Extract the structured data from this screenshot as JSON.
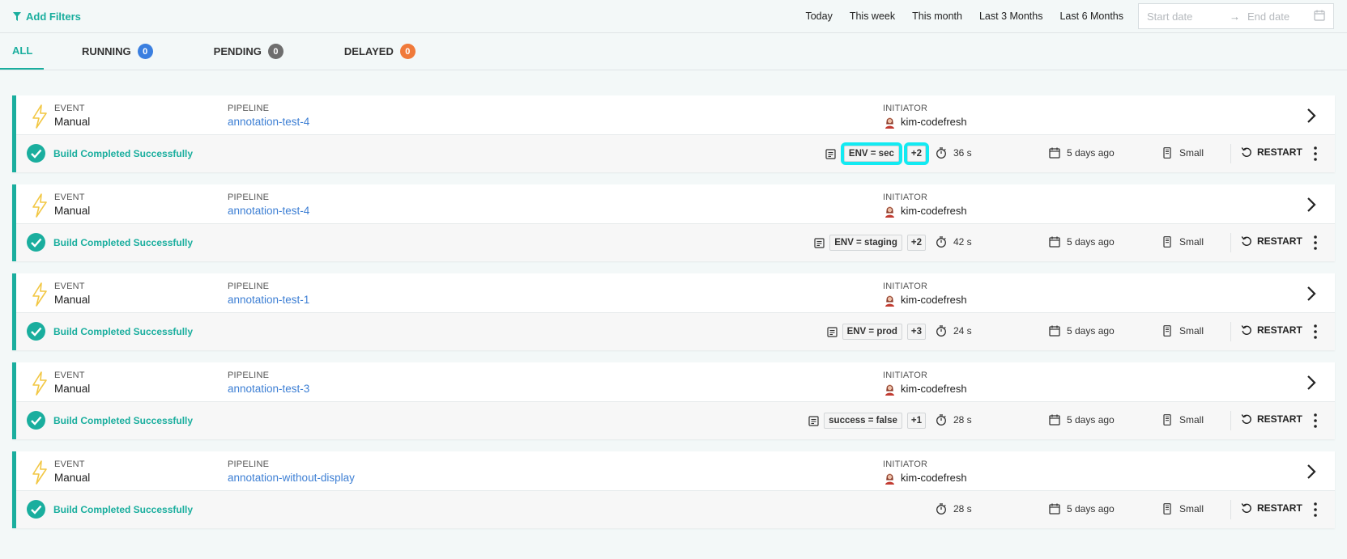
{
  "filters": {
    "add_label": "Add Filters",
    "ranges": [
      "Today",
      "This week",
      "This month",
      "Last 3 Months",
      "Last 6 Months"
    ],
    "start_placeholder": "Start date",
    "end_placeholder": "End date",
    "arrow": "→"
  },
  "tabs": [
    {
      "label": "ALL"
    },
    {
      "label": "RUNNING",
      "count": "0",
      "color": "#3a7fe0"
    },
    {
      "label": "PENDING",
      "count": "0",
      "color": "#6e6e6e"
    },
    {
      "label": "DELAYED",
      "count": "0",
      "color": "#f07a3a"
    }
  ],
  "labels": {
    "event": "EVENT",
    "pipeline": "PIPELINE",
    "initiator": "INITIATOR",
    "restart": "RESTART"
  },
  "builds": [
    {
      "event": "Manual",
      "pipeline": "annotation-test-4",
      "initiator": "kim-codefresh",
      "status": "Build Completed Successfully",
      "annotation": "ENV = sec",
      "more": "+2",
      "duration": "36 s",
      "date": "5 days ago",
      "size": "Small",
      "highlighted": true
    },
    {
      "event": "Manual",
      "pipeline": "annotation-test-4",
      "initiator": "kim-codefresh",
      "status": "Build Completed Successfully",
      "annotation": "ENV = staging",
      "more": "+2",
      "duration": "42 s",
      "date": "5 days ago",
      "size": "Small",
      "highlighted": false
    },
    {
      "event": "Manual",
      "pipeline": "annotation-test-1",
      "initiator": "kim-codefresh",
      "status": "Build Completed Successfully",
      "annotation": "ENV = prod",
      "more": "+3",
      "duration": "24 s",
      "date": "5 days ago",
      "size": "Small",
      "highlighted": false
    },
    {
      "event": "Manual",
      "pipeline": "annotation-test-3",
      "initiator": "kim-codefresh",
      "status": "Build Completed Successfully",
      "annotation": "success = false",
      "more": "+1",
      "duration": "28 s",
      "date": "5 days ago",
      "size": "Small",
      "highlighted": false
    },
    {
      "event": "Manual",
      "pipeline": "annotation-without-display",
      "initiator": "kim-codefresh",
      "status": "Build Completed Successfully",
      "annotation": null,
      "more": null,
      "duration": "28 s",
      "date": "5 days ago",
      "size": "Small",
      "highlighted": false
    }
  ],
  "colors": {
    "accent": "#1aae9e",
    "link": "#3d7fd4",
    "highlight": "#12eaf2",
    "lightning": "#f2c744"
  },
  "icons": {
    "filter": "filter-icon",
    "event": "lightning-icon",
    "status": "check-circle-icon",
    "annotation": "note-icon",
    "duration": "stopwatch-icon",
    "date": "calendar-icon",
    "size": "server-icon",
    "restart": "restart-icon",
    "more": "kebab-menu-icon",
    "open": "chevron-right-icon"
  }
}
